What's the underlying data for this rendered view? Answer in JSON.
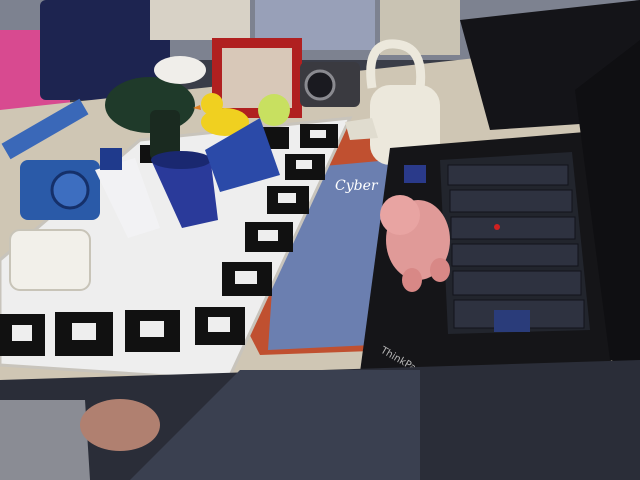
{
  "scene": {
    "laptop_brand": "ThinkPad",
    "magazine_cover_text": "Cyber",
    "colors": {
      "desk": "#cfc6b4",
      "board_white": "#eeeeee",
      "marker_black": "#111111",
      "laptop_body": "#151518",
      "keyboard_key": "#2a2d36",
      "trackpoint": "#d02020",
      "pig_toy": "#e09a98",
      "duck_toy": "#f0d020",
      "tennis_ball": "#c8e060",
      "watering_can": "#ece8dc",
      "cup_blue": "#2a3a9a",
      "jeans": "#3a4050"
    },
    "objects": [
      "marker-board-icon",
      "laptop-icon",
      "pig-toy-icon",
      "watering-can-icon",
      "rubber-duck-icon",
      "tennis-ball-icon",
      "blue-cup-icon",
      "photo-frame-icon",
      "toy-car-icon",
      "hand-icon"
    ]
  }
}
